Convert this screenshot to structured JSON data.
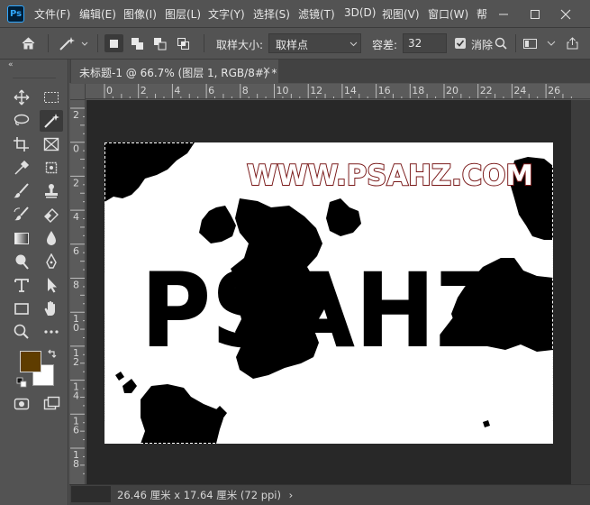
{
  "app": {
    "logo_text": "Ps"
  },
  "menu": {
    "items": [
      "文件(F)",
      "编辑(E)",
      "图像(I)",
      "图层(L)",
      "文字(Y)",
      "选择(S)",
      "滤镜(T)",
      "3D(D)",
      "视图(V)",
      "窗口(W)",
      "帮"
    ]
  },
  "options": {
    "sample_size_label": "取样大小:",
    "sample_size_value": "取样点",
    "tolerance_label": "容差:",
    "tolerance_value": "32",
    "antialias_label": "消除"
  },
  "document": {
    "tab_title": "未标题-1 @ 66.7% (图层 1, RGB/8#) *",
    "close_glyph": "×"
  },
  "rulers": {
    "horizontal": [
      "0",
      "2",
      "4",
      "6",
      "8",
      "10",
      "12",
      "14",
      "16",
      "18",
      "20",
      "22",
      "24",
      "26"
    ],
    "vertical": [
      "2",
      "0",
      "2",
      "4",
      "6",
      "8",
      "1\n0",
      "1\n2",
      "1\n4",
      "1\n6",
      "1\n8"
    ]
  },
  "canvas": {
    "watermark_text": "WWW.PSAHZ.COM",
    "headline_text": "PSAHZ"
  },
  "status": {
    "text": "26.46 厘米 x 17.64 厘米 (72 ppi)",
    "arrow": "›"
  },
  "colors": {
    "foreground": "#5f3d00",
    "background": "#ffffff",
    "ui_panel": "#535353",
    "pasteboard": "#282828",
    "watermark_fill": "#ffffff",
    "watermark_stroke": "#7a1a1a"
  },
  "tools": [
    "move-icon",
    "marquee-icon",
    "lasso-icon",
    "magic-wand-icon",
    "crop-icon",
    "frame-icon",
    "eyedropper-icon",
    "spot-heal-icon",
    "brush-icon",
    "stamp-icon",
    "history-brush-icon",
    "eraser-icon",
    "gradient-icon",
    "blur-icon",
    "dodge-icon",
    "pen-icon",
    "type-icon",
    "path-select-icon",
    "rectangle-icon",
    "hand-icon",
    "zoom-icon",
    "more-icon",
    "quick-mask-icon",
    "screen-mode-icon"
  ]
}
